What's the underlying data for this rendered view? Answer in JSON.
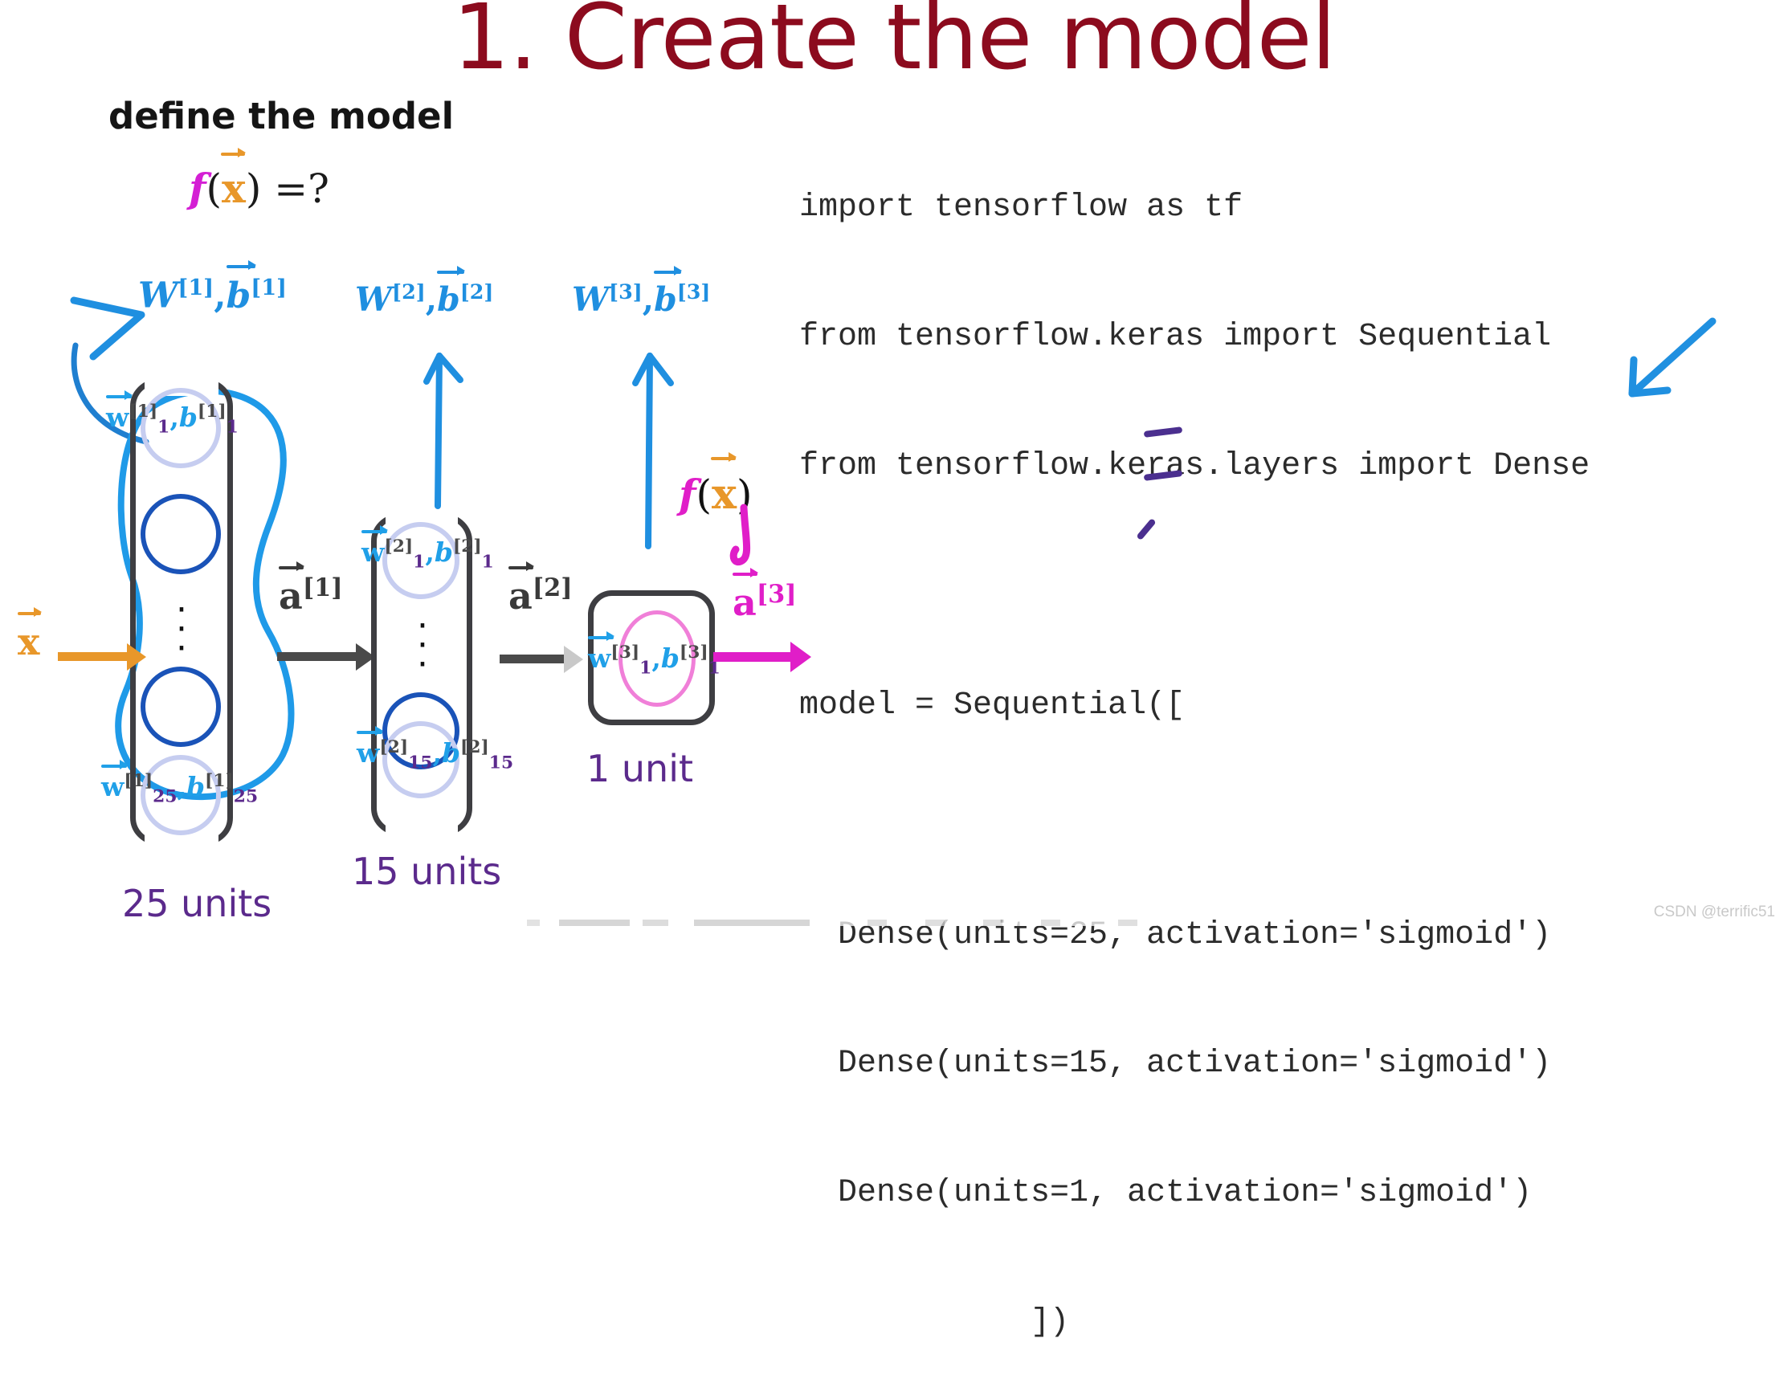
{
  "slide": {
    "title": "1. Create the model",
    "title_color": "#8c0b1e",
    "watermark": "CSDN @terrific51"
  },
  "left_panel": {
    "caption": "define the model",
    "formula": {
      "fn": "f",
      "open": "(",
      "arg": "x",
      "close": ")",
      "equals": " =?"
    },
    "input": {
      "symbol": "x",
      "color": "#e8972a"
    },
    "weight_headers": [
      {
        "w": "W",
        "sup": "[1]",
        "comma": ",",
        "b": "b",
        "bsup": "[1]"
      },
      {
        "w": "W",
        "sup": "[2]",
        "comma": ",",
        "b": "b",
        "bsup": "[2]"
      },
      {
        "w": "W",
        "sup": "[3]",
        "comma": ",",
        "b": "b",
        "bsup": "[3]"
      }
    ],
    "layers": [
      {
        "id": "layer-1",
        "units_caption": "25 units",
        "top_neuron": {
          "w": "w",
          "wsup": "[1]",
          "wsub": "1",
          "b": "b",
          "bsup": "[1]",
          "bsub": "1"
        },
        "bottom_neuron": {
          "w": "w",
          "wsup": "[1]",
          "wsub": "25",
          "b": "b",
          "bsup": "[1]",
          "bsub": "25"
        },
        "output_activation": {
          "a": "a",
          "sup": "[1]"
        }
      },
      {
        "id": "layer-2",
        "units_caption": "15 units",
        "top_neuron": {
          "w": "w",
          "wsup": "[2]",
          "wsub": "1",
          "b": "b",
          "bsup": "[2]",
          "bsub": "1"
        },
        "bottom_neuron": {
          "w": "w",
          "wsup": "[2]",
          "wsub": "15",
          "b": "b",
          "bsup": "[2]",
          "bsub": "15"
        },
        "output_activation": {
          "a": "a",
          "sup": "[2]"
        }
      },
      {
        "id": "layer-3",
        "units_caption": "1 unit",
        "top_neuron": {
          "w": "w",
          "wsup": "[3]",
          "wsub": "1",
          "b": "b",
          "bsup": "[3]",
          "bsub": "1"
        },
        "output_activation": {
          "a": "a",
          "sup": "[3]"
        }
      }
    ],
    "annotation_fx": {
      "fn": "f",
      "open": "(",
      "arg": "x",
      "close": ")"
    },
    "colors": {
      "blue_ink": "#1f8fe0",
      "neuron_blue": "#1a53b8",
      "purple": "#5b2a8c",
      "magenta": "#e01ec8",
      "orange": "#e8972a",
      "gray_box": "#3e3e42"
    }
  },
  "code_panel": {
    "lines": [
      "import tensorflow as tf",
      "from tensorflow.keras import Sequential",
      "from tensorflow.keras.layers import Dense",
      "",
      "model = Sequential([",
      "  Dense(units=25, activation='sigmoid')",
      "  Dense(units=15, activation='sigmoid')",
      "  Dense(units=1, activation='sigmoid')",
      "            ])"
    ],
    "underlined_values": [
      "25",
      "15",
      "1"
    ],
    "annotation_arrow": "blue-down-left-arrow"
  }
}
